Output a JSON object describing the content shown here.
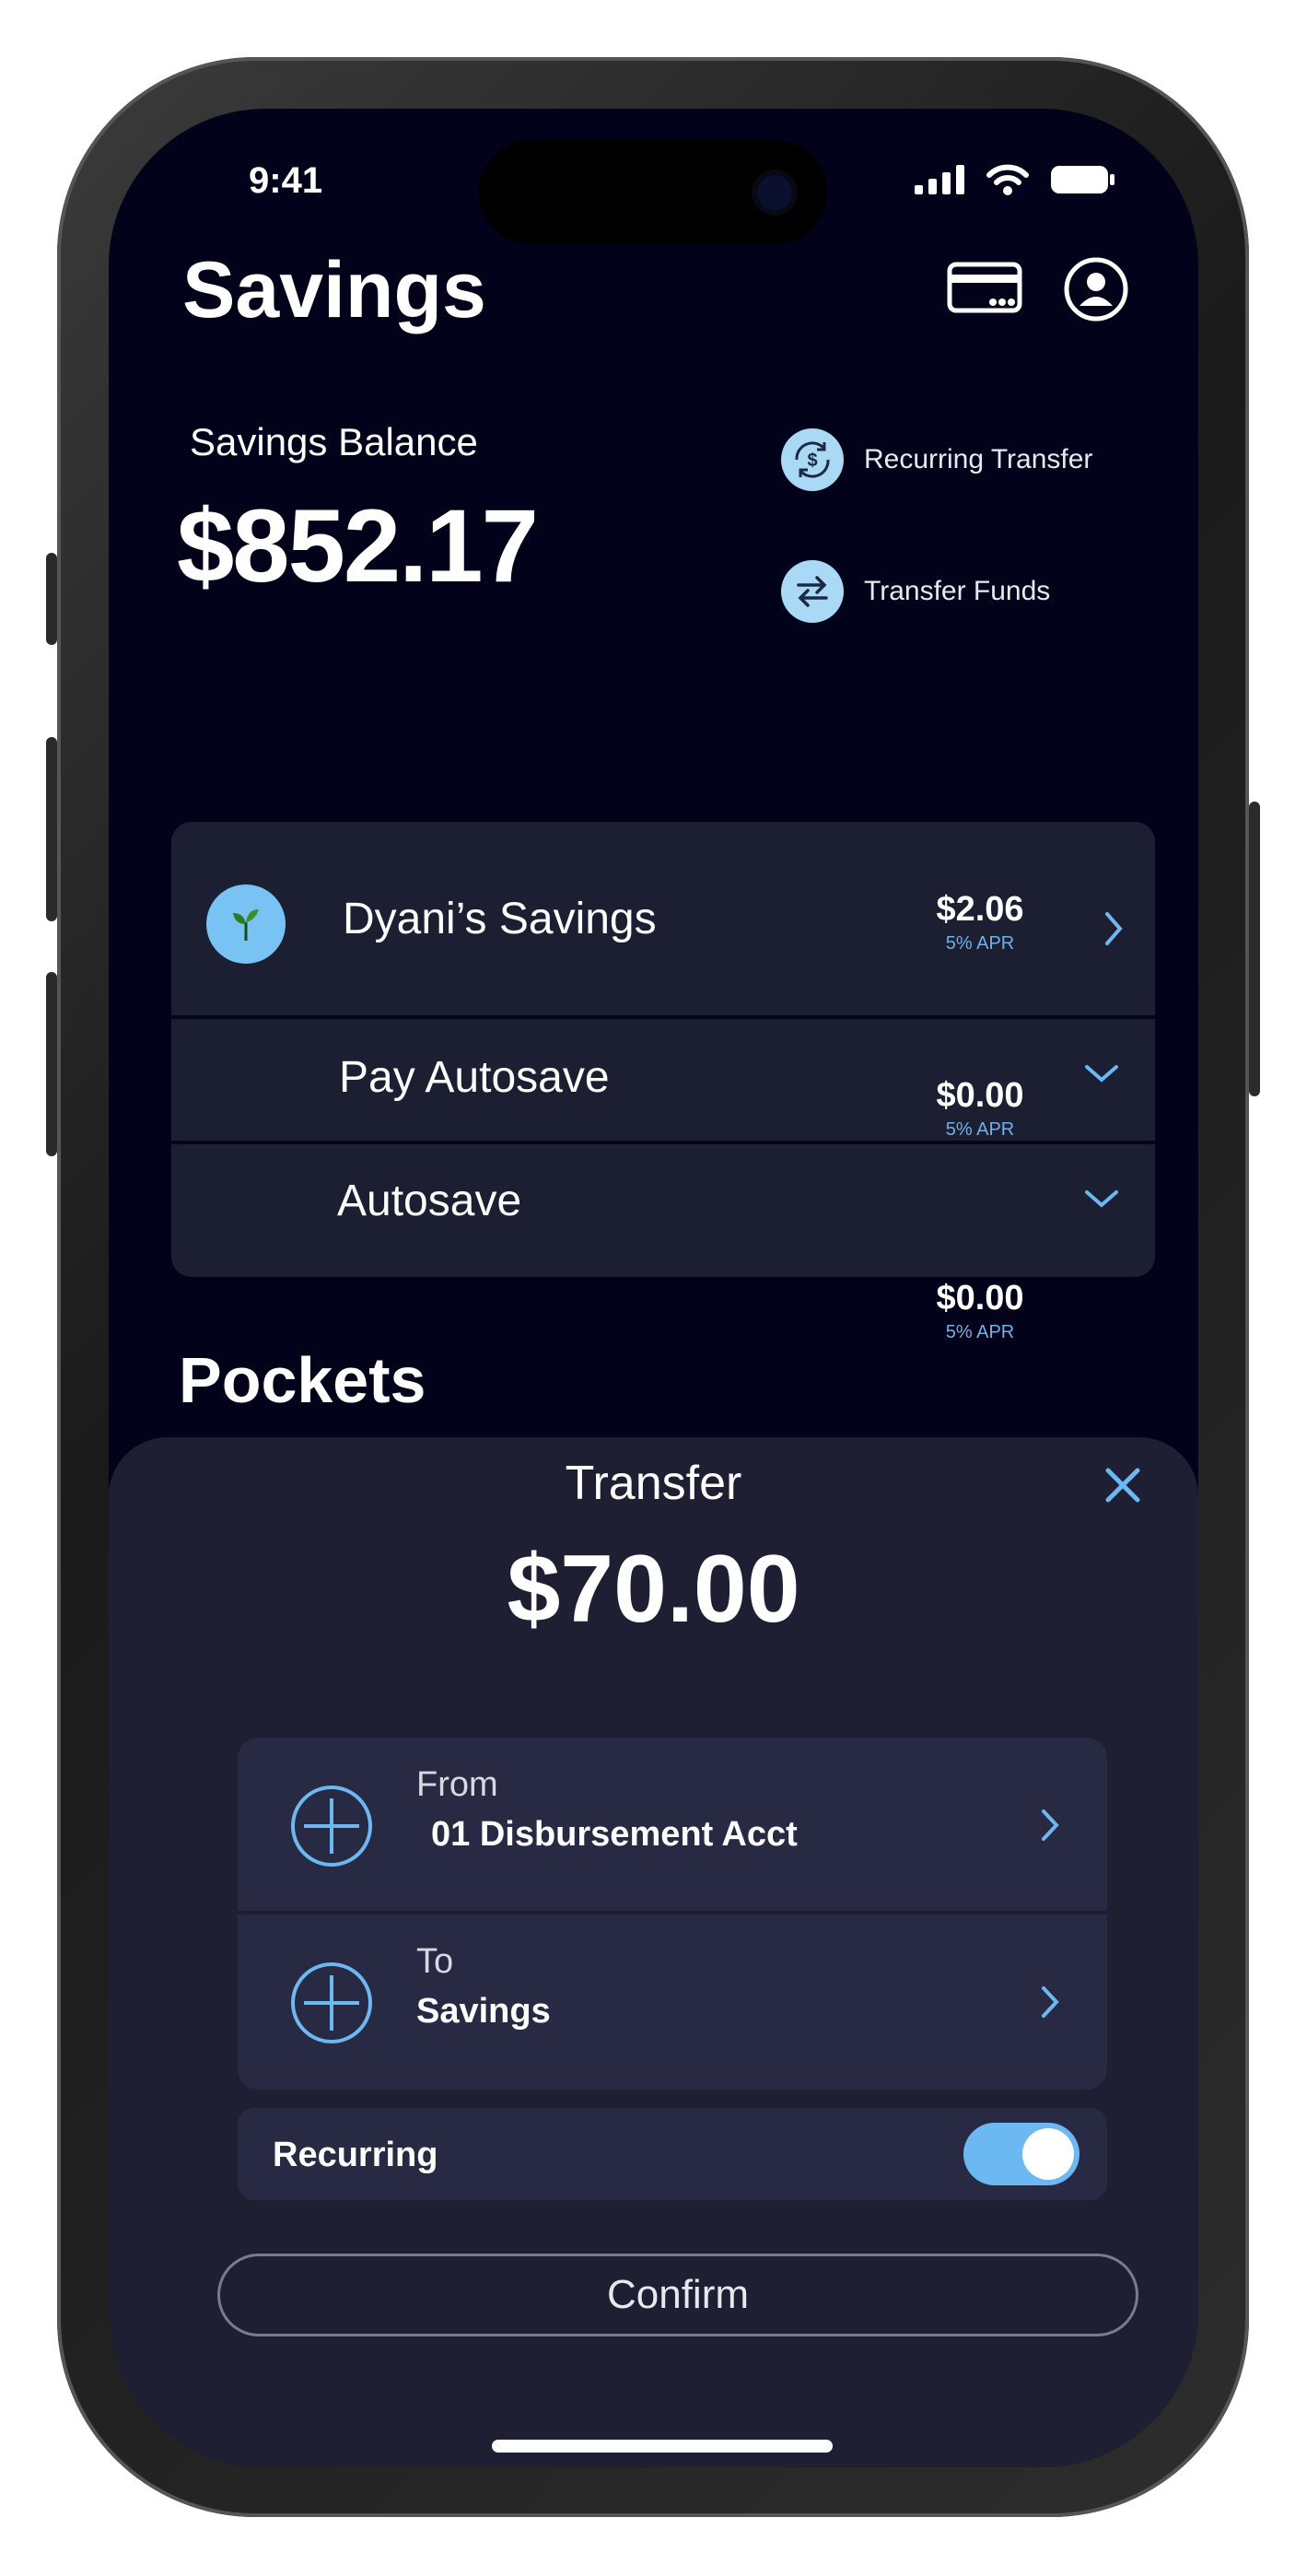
{
  "status_bar": {
    "time": "9:41"
  },
  "header": {
    "title": "Savings",
    "card_icon": "card-icon",
    "profile_icon": "profile-icon"
  },
  "balance": {
    "label": "Savings Balance",
    "value": "$852.17"
  },
  "actions": [
    {
      "label": "Recurring Transfer",
      "icon": "recurring-dollar-icon"
    },
    {
      "label": "Transfer Funds",
      "icon": "transfer-arrows-icon"
    }
  ],
  "accounts": [
    {
      "name": "Dyani’s Savings",
      "amount": "$2.06",
      "apr": "5% APR"
    },
    {
      "name": "Pay Autosave",
      "amount": "$0.00",
      "apr": "5% APR"
    },
    {
      "name": "Autosave",
      "amount": "$0.00",
      "apr": "5% APR"
    }
  ],
  "pockets": {
    "title": "Pockets"
  },
  "transfer_sheet": {
    "title": "Transfer",
    "amount": "$70.00",
    "from_label": "From",
    "from_value": "01 Disbursement Acct",
    "to_label": "To",
    "to_value": "Savings",
    "recurring_label": "Recurring",
    "recurring_on": true,
    "confirm_label": "Confirm"
  },
  "colors": {
    "background": "#02031a",
    "card": "#1c1e32",
    "accent": "#6cb8f2",
    "sheet": "#1e1f33"
  }
}
